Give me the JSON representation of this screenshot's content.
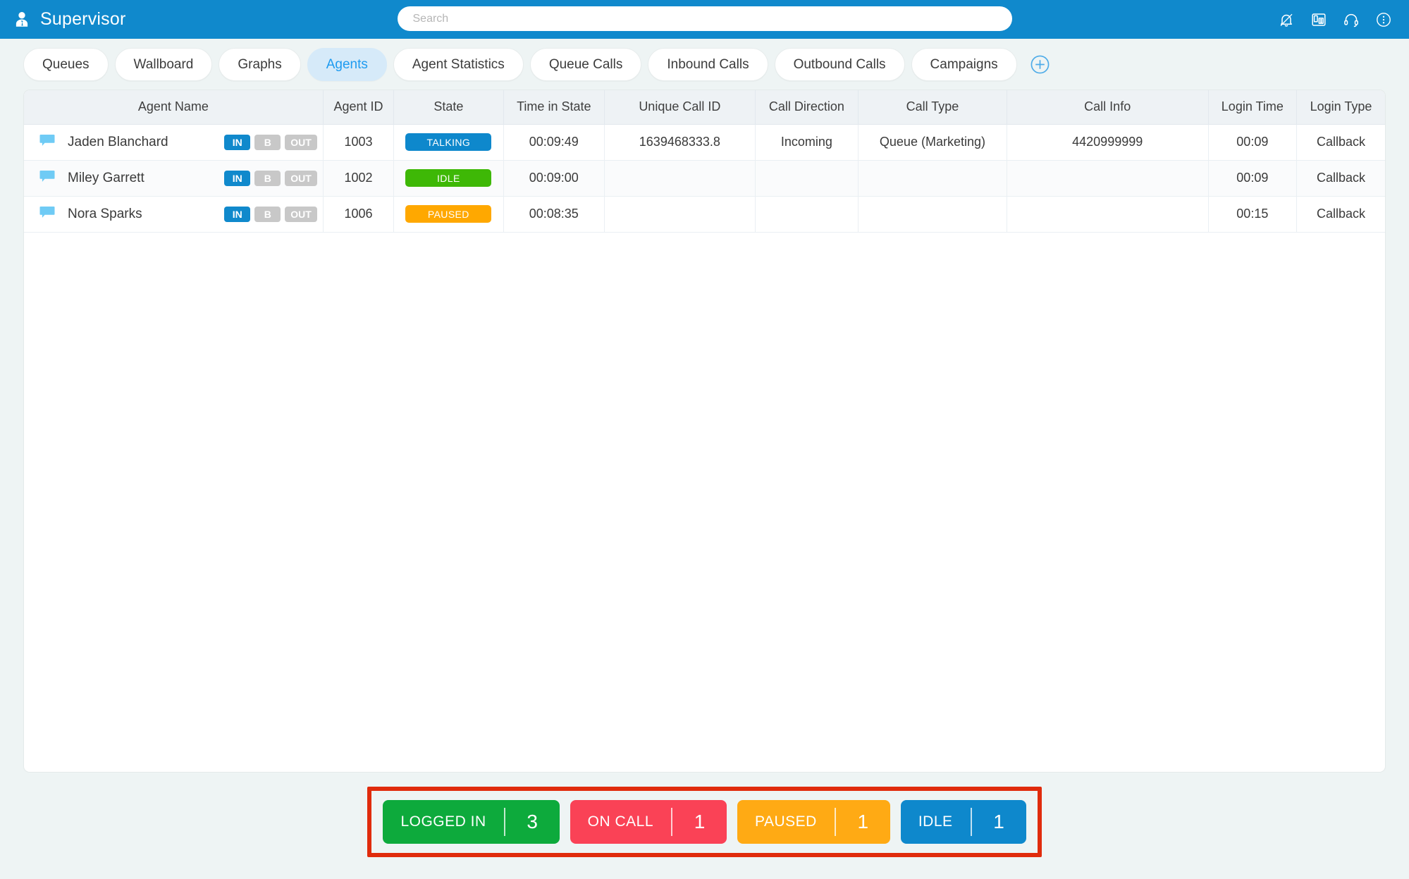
{
  "header": {
    "title": "Supervisor",
    "brand_icon": "user-supervisor-icon",
    "brand_color": "#1089cc",
    "search": {
      "value": "",
      "placeholder": "Search"
    },
    "icons": [
      {
        "name": "bell-icon"
      },
      {
        "name": "desk-phone-icon"
      },
      {
        "name": "headset-icon"
      },
      {
        "name": "more-options-icon"
      }
    ]
  },
  "tabs": {
    "items": [
      {
        "label": "Queues",
        "active": false
      },
      {
        "label": "Wallboard",
        "active": false
      },
      {
        "label": "Graphs",
        "active": false
      },
      {
        "label": "Agents",
        "active": true
      },
      {
        "label": "Agent Statistics",
        "active": false
      },
      {
        "label": "Queue Calls",
        "active": false
      },
      {
        "label": "Inbound Calls",
        "active": false
      },
      {
        "label": "Outbound Calls",
        "active": false
      },
      {
        "label": "Campaigns",
        "active": false
      }
    ],
    "add_tab_icon": "plus-circle-icon",
    "active_bg": "#d6eaf9",
    "active_text": "#1e9bf0"
  },
  "table": {
    "columns": [
      "Agent Name",
      "Agent ID",
      "State",
      "Time in State",
      "Unique Call ID",
      "Call Direction",
      "Call Type",
      "Call Info",
      "Login Time",
      "Login Type"
    ],
    "toggle_labels": {
      "in": "IN",
      "b": "B",
      "out": "OUT"
    },
    "rows": [
      {
        "agent_name": "Jaden Blanchard",
        "chat_icon": "chat-bubble-icon",
        "toggles": {
          "in": true,
          "b": false,
          "out": false
        },
        "agent_id": "1003",
        "state": "TALKING",
        "state_color": "#0e88cc",
        "time_in_state": "00:09:49",
        "unique_call_id": "1639468333.8",
        "call_direction": "Incoming",
        "call_type": "Queue (Marketing)",
        "call_info": "4420999999",
        "login_time": "00:09",
        "login_type": "Callback"
      },
      {
        "agent_name": "Miley Garrett",
        "chat_icon": "chat-bubble-icon",
        "toggles": {
          "in": true,
          "b": false,
          "out": false
        },
        "agent_id": "1002",
        "state": "IDLE",
        "state_color": "#3eb806",
        "time_in_state": "00:09:00",
        "unique_call_id": "",
        "call_direction": "",
        "call_type": "",
        "call_info": "",
        "login_time": "00:09",
        "login_type": "Callback"
      },
      {
        "agent_name": "Nora Sparks",
        "chat_icon": "chat-bubble-icon",
        "toggles": {
          "in": true,
          "b": false,
          "out": false
        },
        "agent_id": "1006",
        "state": "PAUSED",
        "state_color": "#ffa800",
        "time_in_state": "00:08:35",
        "unique_call_id": "",
        "call_direction": "",
        "call_type": "",
        "call_info": "",
        "login_time": "00:15",
        "login_type": "Callback"
      }
    ]
  },
  "summary": {
    "highlight_border_color": "#e02b0c",
    "stats": [
      {
        "label": "LOGGED IN",
        "value": "3",
        "color": "#0daa3c"
      },
      {
        "label": "ON CALL",
        "value": "1",
        "color": "#fa4256"
      },
      {
        "label": "PAUSED",
        "value": "1",
        "color": "#ffaa14"
      },
      {
        "label": "IDLE",
        "value": "1",
        "color": "#0e88cc"
      }
    ]
  }
}
